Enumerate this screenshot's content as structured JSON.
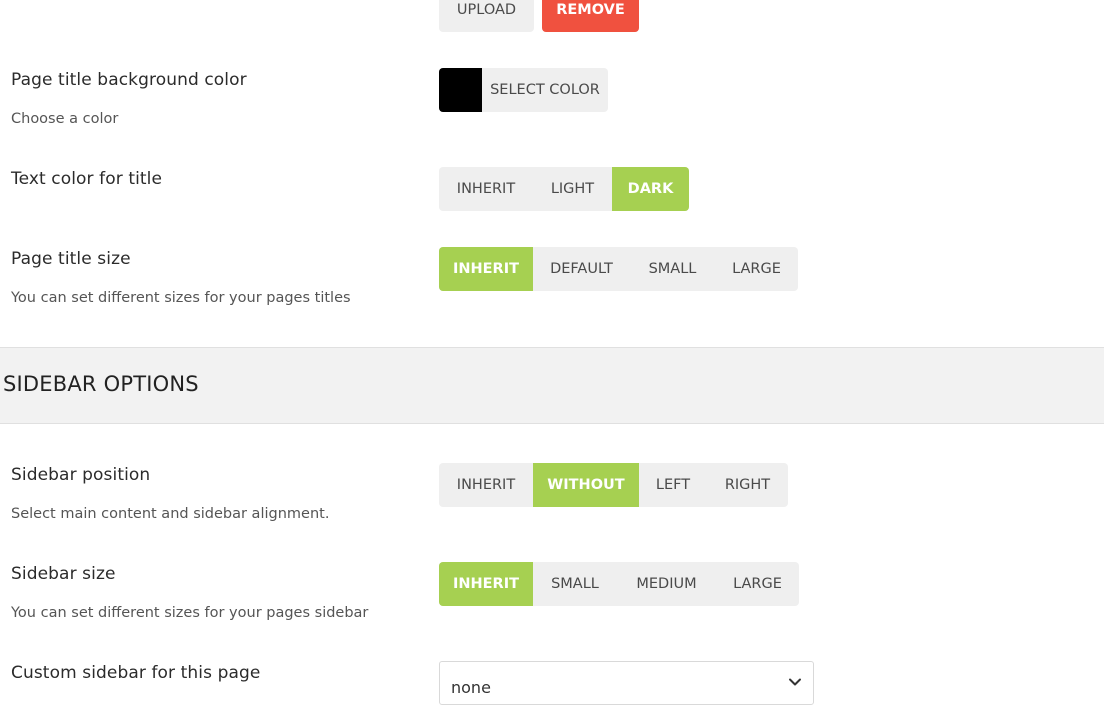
{
  "image_section": {
    "upload_label": "UPLOAD",
    "remove_label": "REMOVE",
    "remove_color": "#f0513f"
  },
  "bg_color": {
    "label": "Page title background color",
    "description": "Choose a color",
    "button_label": "SELECT COLOR",
    "selected_color": "#000000"
  },
  "text_color": {
    "label": "Text color for title",
    "options": [
      "INHERIT",
      "LIGHT",
      "DARK"
    ],
    "selected": "DARK"
  },
  "title_size": {
    "label": "Page title size",
    "description": "You can set different sizes for your pages titles",
    "options": [
      "INHERIT",
      "DEFAULT",
      "SMALL",
      "LARGE"
    ],
    "selected": "INHERIT"
  },
  "sidebar_header": {
    "title": "SIDEBAR OPTIONS"
  },
  "sidebar_position": {
    "label": "Sidebar position",
    "description": "Select main content and sidebar alignment.",
    "options": [
      "INHERIT",
      "WITHOUT",
      "LEFT",
      "RIGHT"
    ],
    "selected": "WITHOUT"
  },
  "sidebar_size": {
    "label": "Sidebar size",
    "description": "You can set different sizes for your pages sidebar",
    "options": [
      "INHERIT",
      "SMALL",
      "MEDIUM",
      "LARGE"
    ],
    "selected": "INHERIT"
  },
  "custom_sidebar": {
    "label": "Custom sidebar for this page",
    "value": "none",
    "icon": "chevron-down-icon"
  },
  "colors": {
    "accent": "#a6d051",
    "button_bg": "#efefef",
    "section_bg": "#f2f2f2"
  }
}
